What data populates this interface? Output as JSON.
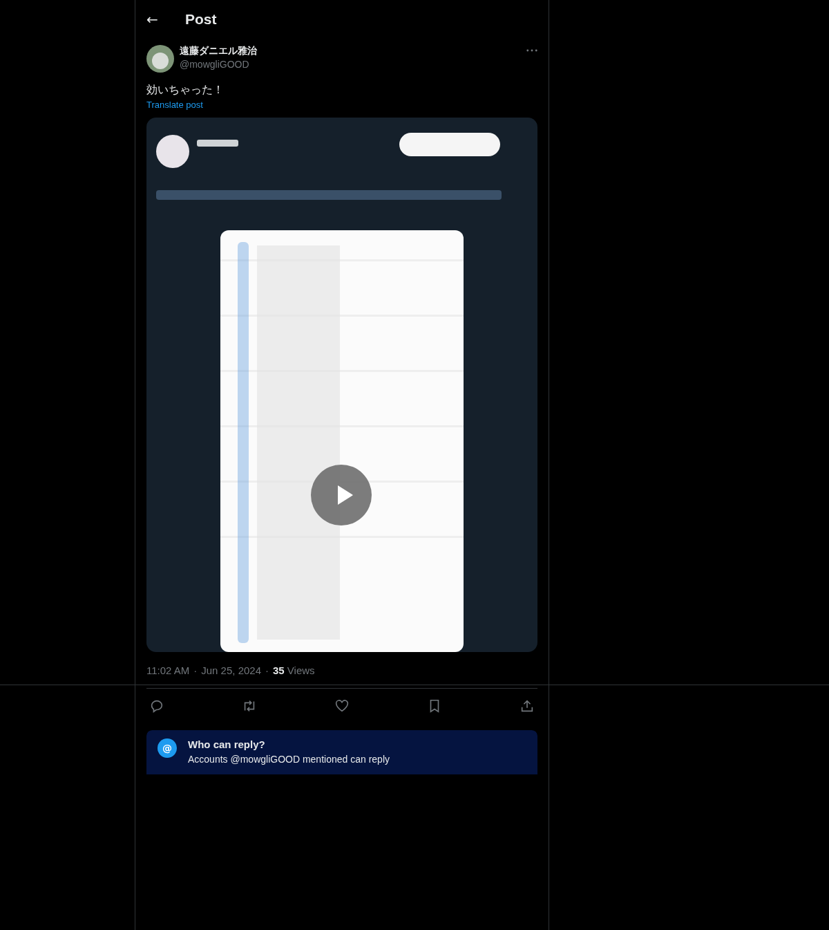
{
  "header": {
    "back_icon": "←",
    "title": "Post"
  },
  "post": {
    "author": {
      "name": "遠藤ダニエル雅治",
      "handle": "@mowgliGOOD"
    },
    "text": "効いちゃった！",
    "translate": "Translate post",
    "meta": {
      "time": "11:02 AM",
      "sep": "·",
      "date": "Jun 25, 2024",
      "views": "**35** Views"
    }
  },
  "actions": [
    {
      "kind": "reply"
    },
    {
      "kind": "repost"
    },
    {
      "kind": "like"
    },
    {
      "kind": "bookmark"
    },
    {
      "kind": "share"
    }
  ],
  "reply_notice": {
    "icon": "@",
    "title": "Who can reply?",
    "text": "Accounts @mowgliGOOD mentioned can reply"
  }
}
